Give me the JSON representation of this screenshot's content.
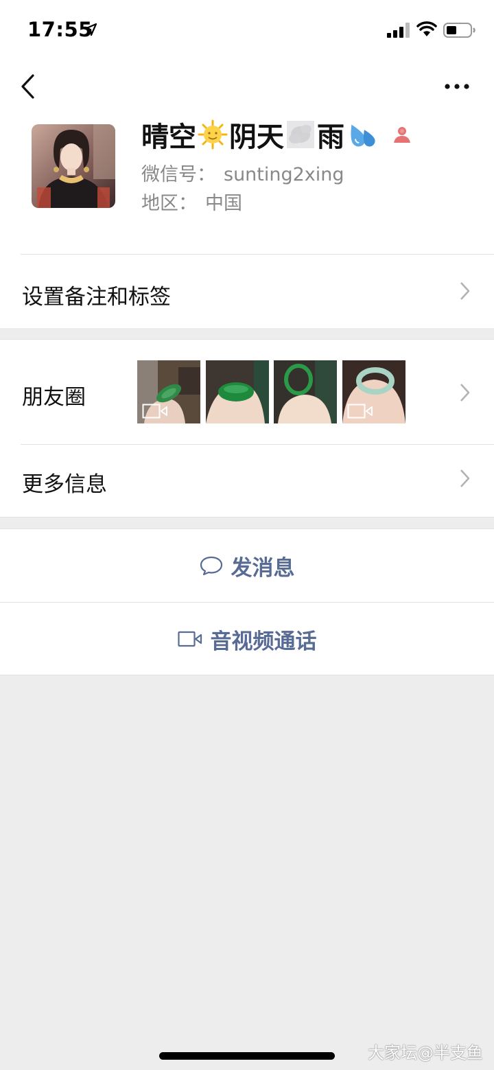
{
  "status_bar": {
    "time": "17:55"
  },
  "profile": {
    "nickname_parts": [
      "晴空",
      "阴天",
      "雨"
    ],
    "wechat_id_label": "微信号：",
    "wechat_id": "sunting2xing",
    "region_label": "地区：",
    "region": "中国"
  },
  "menu": {
    "remark_label": "设置备注和标签",
    "moments_label": "朋友圈",
    "more_info_label": "更多信息"
  },
  "actions": {
    "message_label": "发消息",
    "call_label": "音视频通话"
  },
  "watermark": "大家坛@半支鱼",
  "colors": {
    "link": "#576b95",
    "background": "#ededed",
    "female_icon": "#e57373"
  }
}
